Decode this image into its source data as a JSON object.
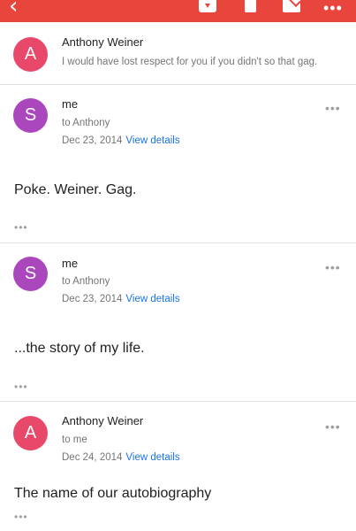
{
  "toolbar": {
    "back_glyph": "‹",
    "more_glyph": "•••",
    "icons": [
      "back-icon",
      "archive-icon",
      "trash-icon",
      "mail-icon",
      "more-icon"
    ],
    "color": "#e8453c"
  },
  "messages": [
    {
      "avatar_letter": "A",
      "avatar_color": "#e8496a",
      "sender": "Anthony Weiner",
      "snippet": "I would have lost respect for you if you didn't so that gag."
    },
    {
      "avatar_letter": "S",
      "avatar_color": "#ab47bc",
      "sender": "me",
      "recipient": "to Anthony",
      "date": "Dec 23, 2014",
      "details_link": "View details",
      "menu_glyph": "•••",
      "body": "Poke. Weiner. Gag.",
      "expand_glyph": "•••"
    },
    {
      "avatar_letter": "S",
      "avatar_color": "#ab47bc",
      "sender": "me",
      "recipient": "to Anthony",
      "date": "Dec 23, 2014",
      "details_link": "View details",
      "menu_glyph": "•••",
      "body": "...the story of my life.",
      "expand_glyph": "•••"
    },
    {
      "avatar_letter": "A",
      "avatar_color": "#e8496a",
      "sender": "Anthony Weiner",
      "recipient": "to me",
      "date": "Dec 24, 2014",
      "details_link": "View details",
      "menu_glyph": "•••",
      "body": "The name of our autobiography",
      "expand_glyph": "•••"
    }
  ]
}
